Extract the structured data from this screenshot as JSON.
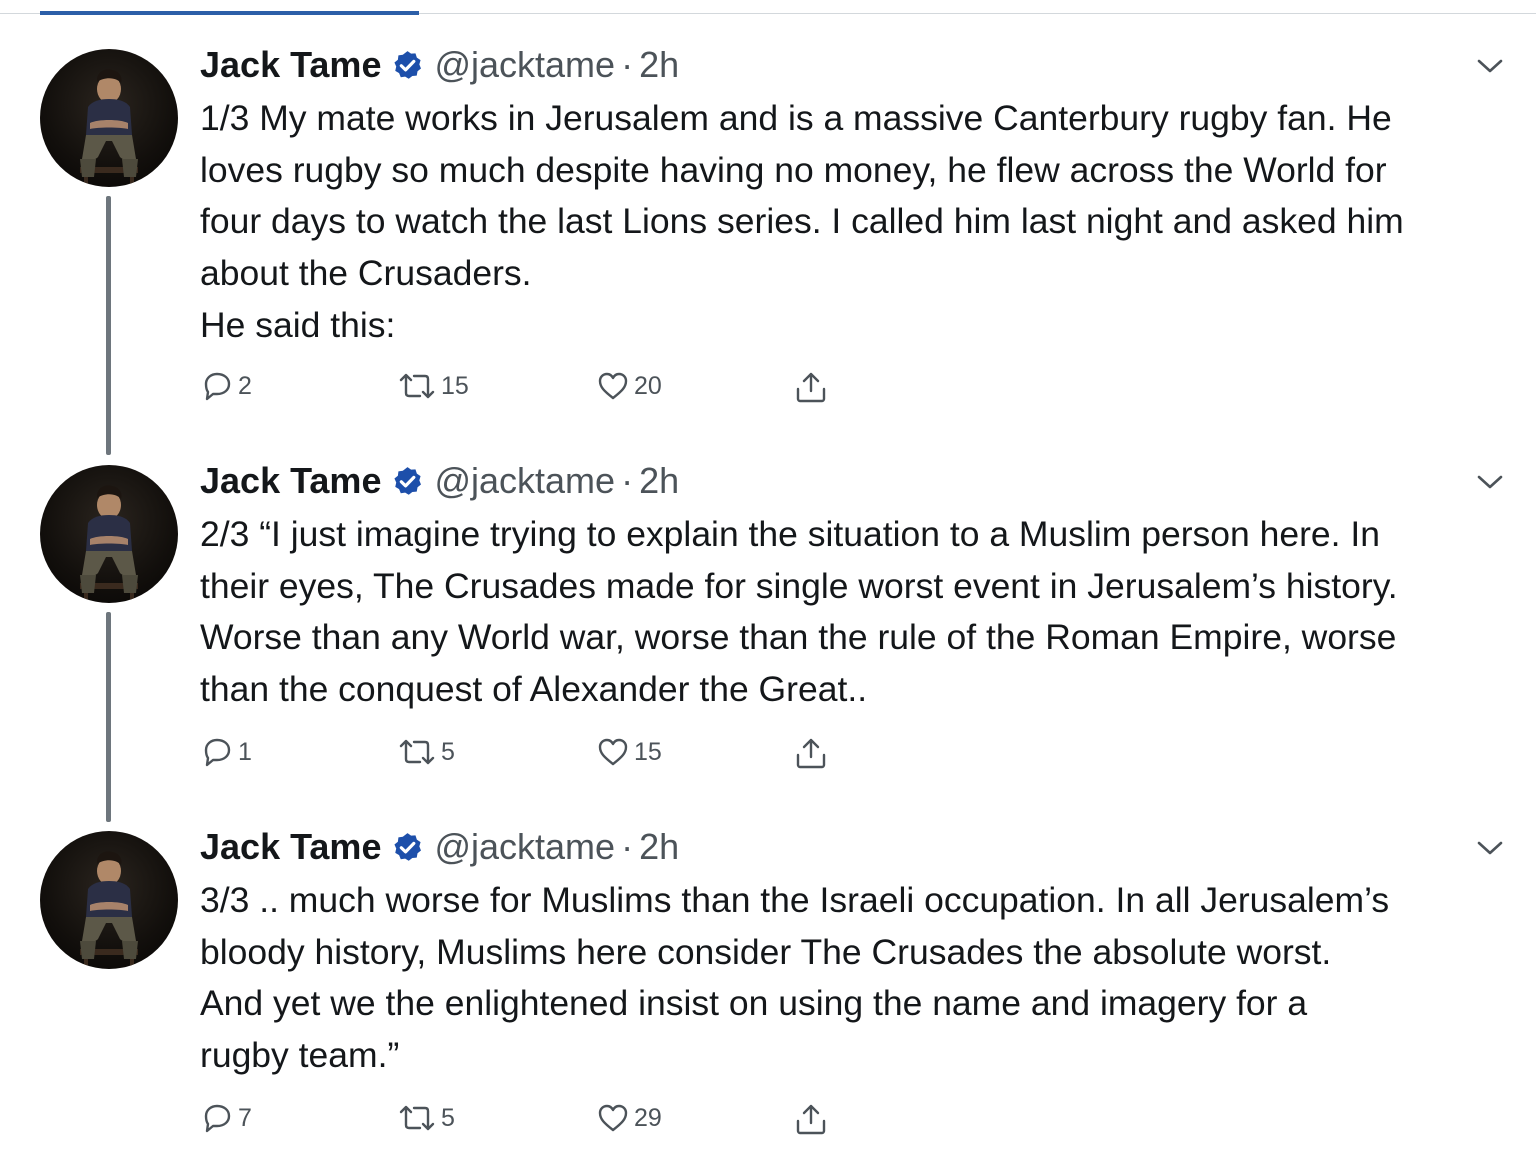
{
  "thread": {
    "tweets": [
      {
        "name": "Jack Tame",
        "handle": "@jacktame",
        "time": "2h",
        "lines": [
          "1/3 My mate works in Jerusalem and is a massive Canterbury rugby fan. He",
          "loves rugby so much despite having no money, he flew across the World for",
          "four days to watch the last Lions series. I called him last night and asked him",
          "about the Crusaders.",
          "He said this:"
        ],
        "replies": "2",
        "retweets": "15",
        "likes": "20"
      },
      {
        "name": "Jack Tame",
        "handle": "@jacktame",
        "time": "2h",
        "lines": [
          "2/3 “I just imagine trying to explain the situation to a Muslim person here. In",
          "their eyes, The Crusades made for single worst event in Jerusalem’s history.",
          "Worse than any World war, worse than the rule of the Roman Empire, worse",
          "than the conquest of Alexander the Great.."
        ],
        "replies": "1",
        "retweets": "5",
        "likes": "15"
      },
      {
        "name": "Jack Tame",
        "handle": "@jacktame",
        "time": "2h",
        "lines": [
          "3/3 .. much worse for Muslims than the Israeli occupation. In all Jerusalem’s",
          "bloody history, Muslims here consider The Crusades the absolute worst.",
          "And yet we the enlightened insist on using the name and imagery for a",
          "rugby team.”"
        ],
        "replies": "7",
        "retweets": "5",
        "likes": "29"
      }
    ]
  },
  "icons": {
    "verified": "verified-badge-icon",
    "more": "chevron-down-icon",
    "reply": "reply-icon",
    "retweet": "retweet-icon",
    "like": "heart-icon",
    "share": "share-icon"
  },
  "colors": {
    "accent": "#2c5fa8",
    "verified": "#1d4faa",
    "secondary_text": "#4c5359",
    "thread_line": "#6e767d"
  }
}
